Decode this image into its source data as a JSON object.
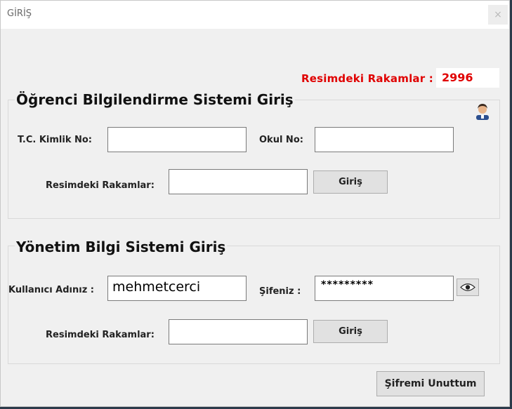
{
  "window": {
    "title": "GİRİŞ",
    "close_label": "×"
  },
  "captcha": {
    "label": "Resimdeki Rakamlar :",
    "value": "2996"
  },
  "student": {
    "title": "Öğrenci Bilgilendirme Sistemi Giriş",
    "tc_label": "T.C. Kimlik No:",
    "tc_value": "",
    "school_label": "Okul No:",
    "school_value": "",
    "captcha_label": "Resimdeki Rakamlar:",
    "captcha_value": "",
    "login_label": "Giriş",
    "user_icon": "user-icon"
  },
  "admin": {
    "title": "Yönetim Bilgi Sistemi Giriş",
    "username_label": "Kullanıcı Adınız :",
    "username_value": "mehmetcerci",
    "password_label": "Şifeniz :",
    "password_value": "*********",
    "show_password_icon": "eye-icon",
    "captcha_label": "Resimdeki Rakamlar:",
    "captcha_value": "",
    "login_label": "Giriş"
  },
  "forgot_label": "Şifremi Unuttum",
  "colors": {
    "captcha": "#e00000",
    "window_bg": "#f0f0f0"
  }
}
